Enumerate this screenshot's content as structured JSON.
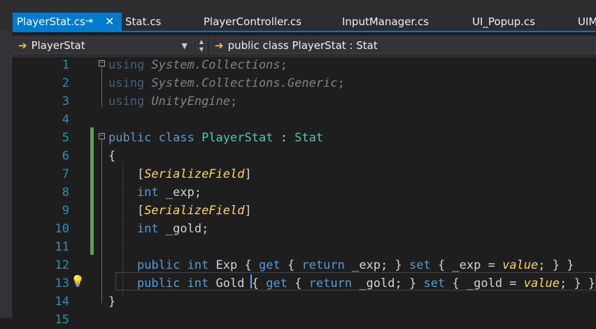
{
  "tabs": [
    {
      "label": "PlayerStat.cs",
      "active": true
    },
    {
      "label": "Stat.cs"
    },
    {
      "label": "PlayerController.cs"
    },
    {
      "label": "InputManager.cs"
    },
    {
      "label": "UI_Popup.cs"
    },
    {
      "label": "UIM"
    }
  ],
  "tab_icons": {
    "pin": "pin-icon",
    "close": "close-icon"
  },
  "navbar": {
    "left_value": "PlayerStat",
    "right_value": "public class PlayerStat : Stat"
  },
  "editor": {
    "line_numbers": [
      "1",
      "2",
      "3",
      "4",
      "5",
      "6",
      "7",
      "8",
      "9",
      "10",
      "11",
      "12",
      "13",
      "14",
      "15"
    ],
    "lines": [
      {
        "t": [
          [
            "using ",
            "kw"
          ],
          [
            "System.Collections",
            "ns-i"
          ],
          [
            ";",
            "ns"
          ]
        ]
      },
      {
        "t": [
          [
            "using ",
            "kw"
          ],
          [
            "System.Collections.Generic",
            "ns-i"
          ],
          [
            ";",
            "ns"
          ]
        ]
      },
      {
        "t": [
          [
            "using ",
            "kw"
          ],
          [
            "UnityEngine",
            "ns-i"
          ],
          [
            ";",
            "ns"
          ]
        ]
      },
      {
        "t": []
      },
      {
        "t": [
          [
            "public ",
            "kw"
          ],
          [
            "class ",
            "kw"
          ],
          [
            "PlayerStat ",
            "cls"
          ],
          [
            ": ",
            "ns"
          ],
          [
            "Stat",
            "cls"
          ]
        ]
      },
      {
        "t": [
          [
            "{",
            "ns"
          ]
        ]
      },
      {
        "t": [
          [
            "    [",
            "ns"
          ],
          [
            "SerializeField",
            "attr"
          ],
          [
            "]",
            "ns"
          ]
        ]
      },
      {
        "t": [
          [
            "    int ",
            "kw"
          ],
          [
            "_exp;",
            "ns"
          ]
        ]
      },
      {
        "t": [
          [
            "    [",
            "ns"
          ],
          [
            "SerializeField",
            "attr"
          ],
          [
            "]",
            "ns"
          ]
        ]
      },
      {
        "t": [
          [
            "    int ",
            "kw"
          ],
          [
            "_gold;",
            "ns"
          ]
        ]
      },
      {
        "t": []
      },
      {
        "t": [
          [
            "    public ",
            "kw"
          ],
          [
            "int ",
            "kw"
          ],
          [
            "Exp ",
            "ns"
          ],
          [
            "{ ",
            "ns"
          ],
          [
            "get ",
            "kw"
          ],
          [
            "{ ",
            "ns"
          ],
          [
            "return ",
            "kw"
          ],
          [
            "_exp; ",
            "ns"
          ],
          [
            "} ",
            "ns"
          ],
          [
            "set ",
            "kw"
          ],
          [
            "{ ",
            "ns"
          ],
          [
            "_exp = ",
            "ns"
          ],
          [
            "value",
            "val"
          ],
          [
            "; } }",
            "ns"
          ]
        ]
      },
      {
        "t": [
          [
            "    public ",
            "kw"
          ],
          [
            "int ",
            "kw"
          ],
          [
            "Gold ",
            "ns"
          ],
          [
            "{ ",
            "ns"
          ],
          [
            "get ",
            "kw"
          ],
          [
            "{ ",
            "ns"
          ],
          [
            "return ",
            "kw"
          ],
          [
            "_gold; ",
            "ns"
          ],
          [
            "} ",
            "ns"
          ],
          [
            "set ",
            "kw"
          ],
          [
            "{ ",
            "ns"
          ],
          [
            "_gold = ",
            "ns"
          ],
          [
            "value",
            "val"
          ],
          [
            "; } }",
            "ns"
          ]
        ]
      },
      {
        "t": [
          [
            "}",
            "ns"
          ]
        ]
      },
      {
        "t": []
      }
    ]
  },
  "icons": {
    "nav_arrow": "arrow-right-icon",
    "dropdown": "chevron-down-icon",
    "lightbulb": "lightbulb-icon"
  }
}
